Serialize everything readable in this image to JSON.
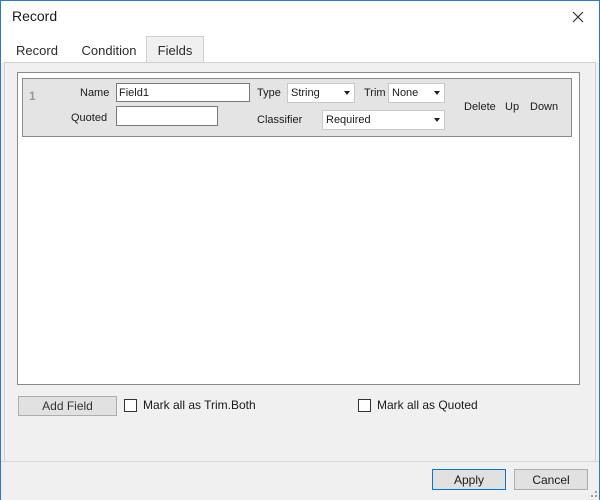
{
  "window": {
    "title": "Record"
  },
  "tabs": [
    {
      "label": "Record"
    },
    {
      "label": "Condition"
    },
    {
      "label": "Fields"
    }
  ],
  "fields": [
    {
      "number": "1",
      "name_label": "Name",
      "name_value": "Field1",
      "quoted_label": "Quoted",
      "quoted_value": "",
      "type_label": "Type",
      "type_value": "String",
      "trim_label": "Trim",
      "trim_value": "None",
      "classifier_label": "Classifier",
      "classifier_value": "Required",
      "delete_label": "Delete",
      "up_label": "Up",
      "down_label": "Down"
    }
  ],
  "bottom": {
    "add_field_label": "Add Field",
    "mark_trim_label": "Mark all as Trim.Both",
    "mark_quoted_label": "Mark all as Quoted"
  },
  "footer": {
    "apply_label": "Apply",
    "cancel_label": "Cancel"
  }
}
